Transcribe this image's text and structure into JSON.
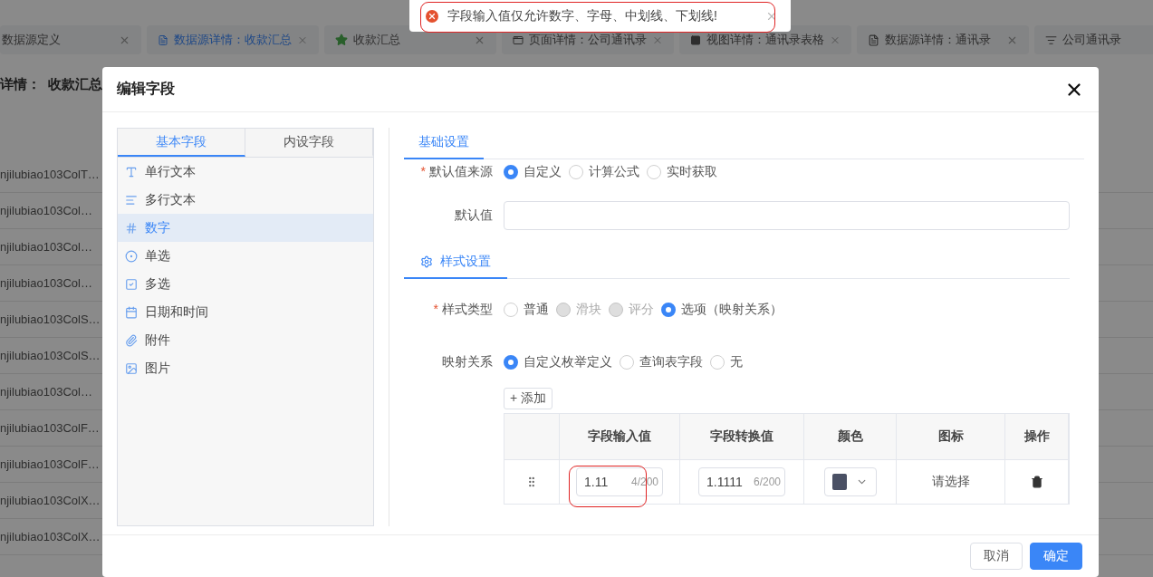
{
  "background_page": {
    "tabs": [
      {
        "label": "数据源定义",
        "kind": "plain",
        "selected": false
      },
      {
        "label": "数据源详情：收款汇总",
        "kind": "datasource",
        "selected": true
      },
      {
        "label": "收款汇总",
        "kind": "favorite",
        "selected": false
      },
      {
        "label": "页面详情：公司通讯录",
        "kind": "page",
        "selected": false
      },
      {
        "label": "视图详情：通讯录表格",
        "kind": "view",
        "selected": false
      },
      {
        "label": "数据源详情：通讯录",
        "kind": "datasource",
        "selected": false
      },
      {
        "label": "公司通讯录",
        "kind": "list",
        "selected": false
      }
    ],
    "heading": "详情：  收款汇总",
    "rows": [
      "njilubiao103ColT…",
      "njilubiao103Col…",
      "njilubiao103Col…",
      "njilubiao103Col…",
      "njilubiao103ColS…",
      "njilubiao103ColS…",
      "njilubiao103Col…",
      "njilubiao103ColF…",
      "njilubiao103ColF…",
      "njilubiao103ColX…",
      "njilubiao103ColX…"
    ]
  },
  "toast": {
    "kind": "error",
    "message": "字段输入值仅允许数字、字母、中划线、下划线!"
  },
  "modal": {
    "title": "编辑字段",
    "field_tabs": [
      {
        "label": "基本字段",
        "selected": true
      },
      {
        "label": "内设字段",
        "selected": false
      }
    ],
    "field_types": [
      {
        "label": "单行文本",
        "kind": "text",
        "selected": false
      },
      {
        "label": "多行文本",
        "kind": "multitext",
        "selected": false
      },
      {
        "label": "数字",
        "kind": "number",
        "selected": true
      },
      {
        "label": "单选",
        "kind": "radio",
        "selected": false
      },
      {
        "label": "多选",
        "kind": "checkbox",
        "selected": false
      },
      {
        "label": "日期和时间",
        "kind": "datetime",
        "selected": false
      },
      {
        "label": "附件",
        "kind": "attachment",
        "selected": false
      },
      {
        "label": "图片",
        "kind": "image",
        "selected": false
      }
    ],
    "settings_tabs": [
      {
        "label": "基础设置",
        "selected": true
      }
    ],
    "default_source": {
      "label": "默认值来源",
      "required_mark": "*",
      "options": [
        {
          "label": "自定义",
          "selected": true,
          "disabled": false
        },
        {
          "label": "计算公式",
          "selected": false,
          "disabled": false
        },
        {
          "label": "实时获取",
          "selected": false,
          "disabled": false
        }
      ]
    },
    "default_value": {
      "label": "默认值"
    },
    "style_section": {
      "title": "样式设置"
    },
    "style_type": {
      "label": "样式类型",
      "required_mark": "*",
      "options": [
        {
          "label": "普通",
          "selected": false,
          "disabled": false
        },
        {
          "label": "滑块",
          "selected": false,
          "disabled": true
        },
        {
          "label": "评分",
          "selected": false,
          "disabled": true
        },
        {
          "label": "选项（映射关系）",
          "selected": true,
          "disabled": false
        }
      ]
    },
    "mapping": {
      "label": "映射关系",
      "options": [
        {
          "label": "自定义枚举定义",
          "selected": true,
          "disabled": false
        },
        {
          "label": "查询表字段",
          "selected": false,
          "disabled": false
        },
        {
          "label": "无",
          "selected": false,
          "disabled": false
        }
      ]
    },
    "add_button": "+ 添加",
    "table": {
      "columns": [
        "字段输入值",
        "字段转换值",
        "颜色",
        "图标",
        "操作"
      ],
      "rows": [
        {
          "input_value": "1.11",
          "input_count": "4/200",
          "converted_value": "1.1111",
          "converted_count": "6/200",
          "color": "#4a5064",
          "icon_placeholder": "请选择"
        }
      ]
    },
    "buttons": {
      "cancel": "取消",
      "confirm": "确定"
    }
  }
}
